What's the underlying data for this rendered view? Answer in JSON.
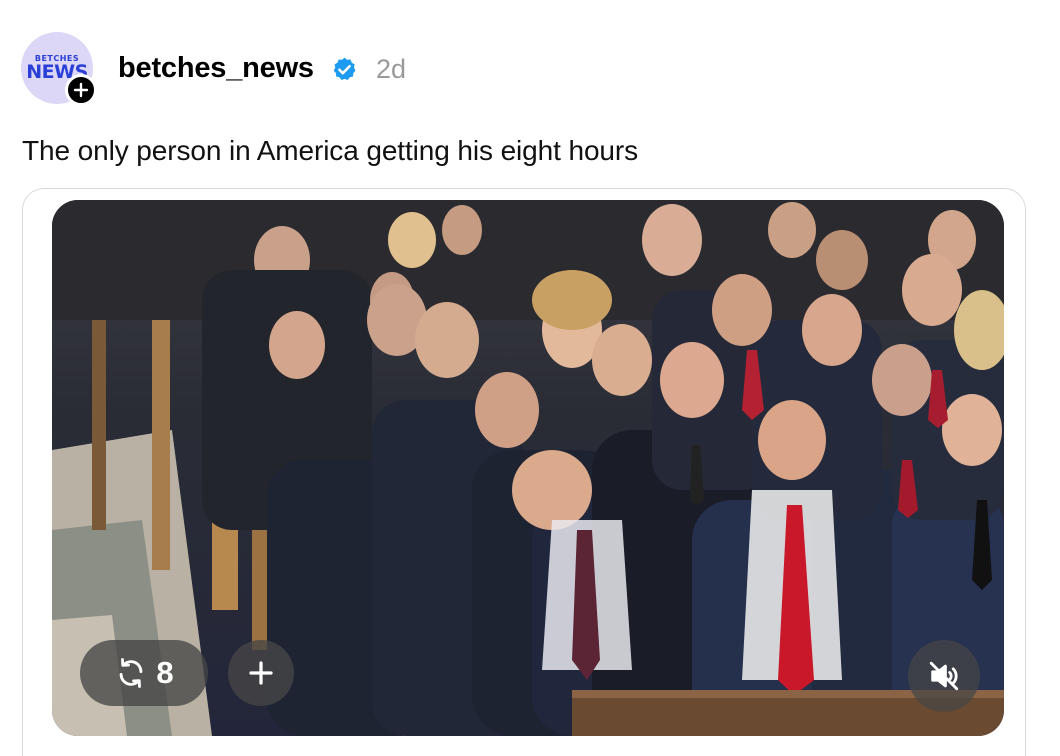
{
  "post": {
    "avatar": {
      "brand_top": "BETCHES",
      "brand_main": "NEWS",
      "bg_color": "#dcd6f7",
      "brand_color": "#2a3fd6",
      "follow_icon": "plus-icon"
    },
    "username": "betches_news",
    "verified_icon": "verified-badge-icon",
    "verified_color": "#1d9bf0",
    "timestamp": "2d",
    "caption": "The only person in America getting his eight hours"
  },
  "media": {
    "description_icon": "video-thumbnail",
    "repost_icon": "repost-icon",
    "repost_count": "8",
    "add_icon": "plus-icon",
    "mute_icon": "speaker-muted-icon"
  }
}
